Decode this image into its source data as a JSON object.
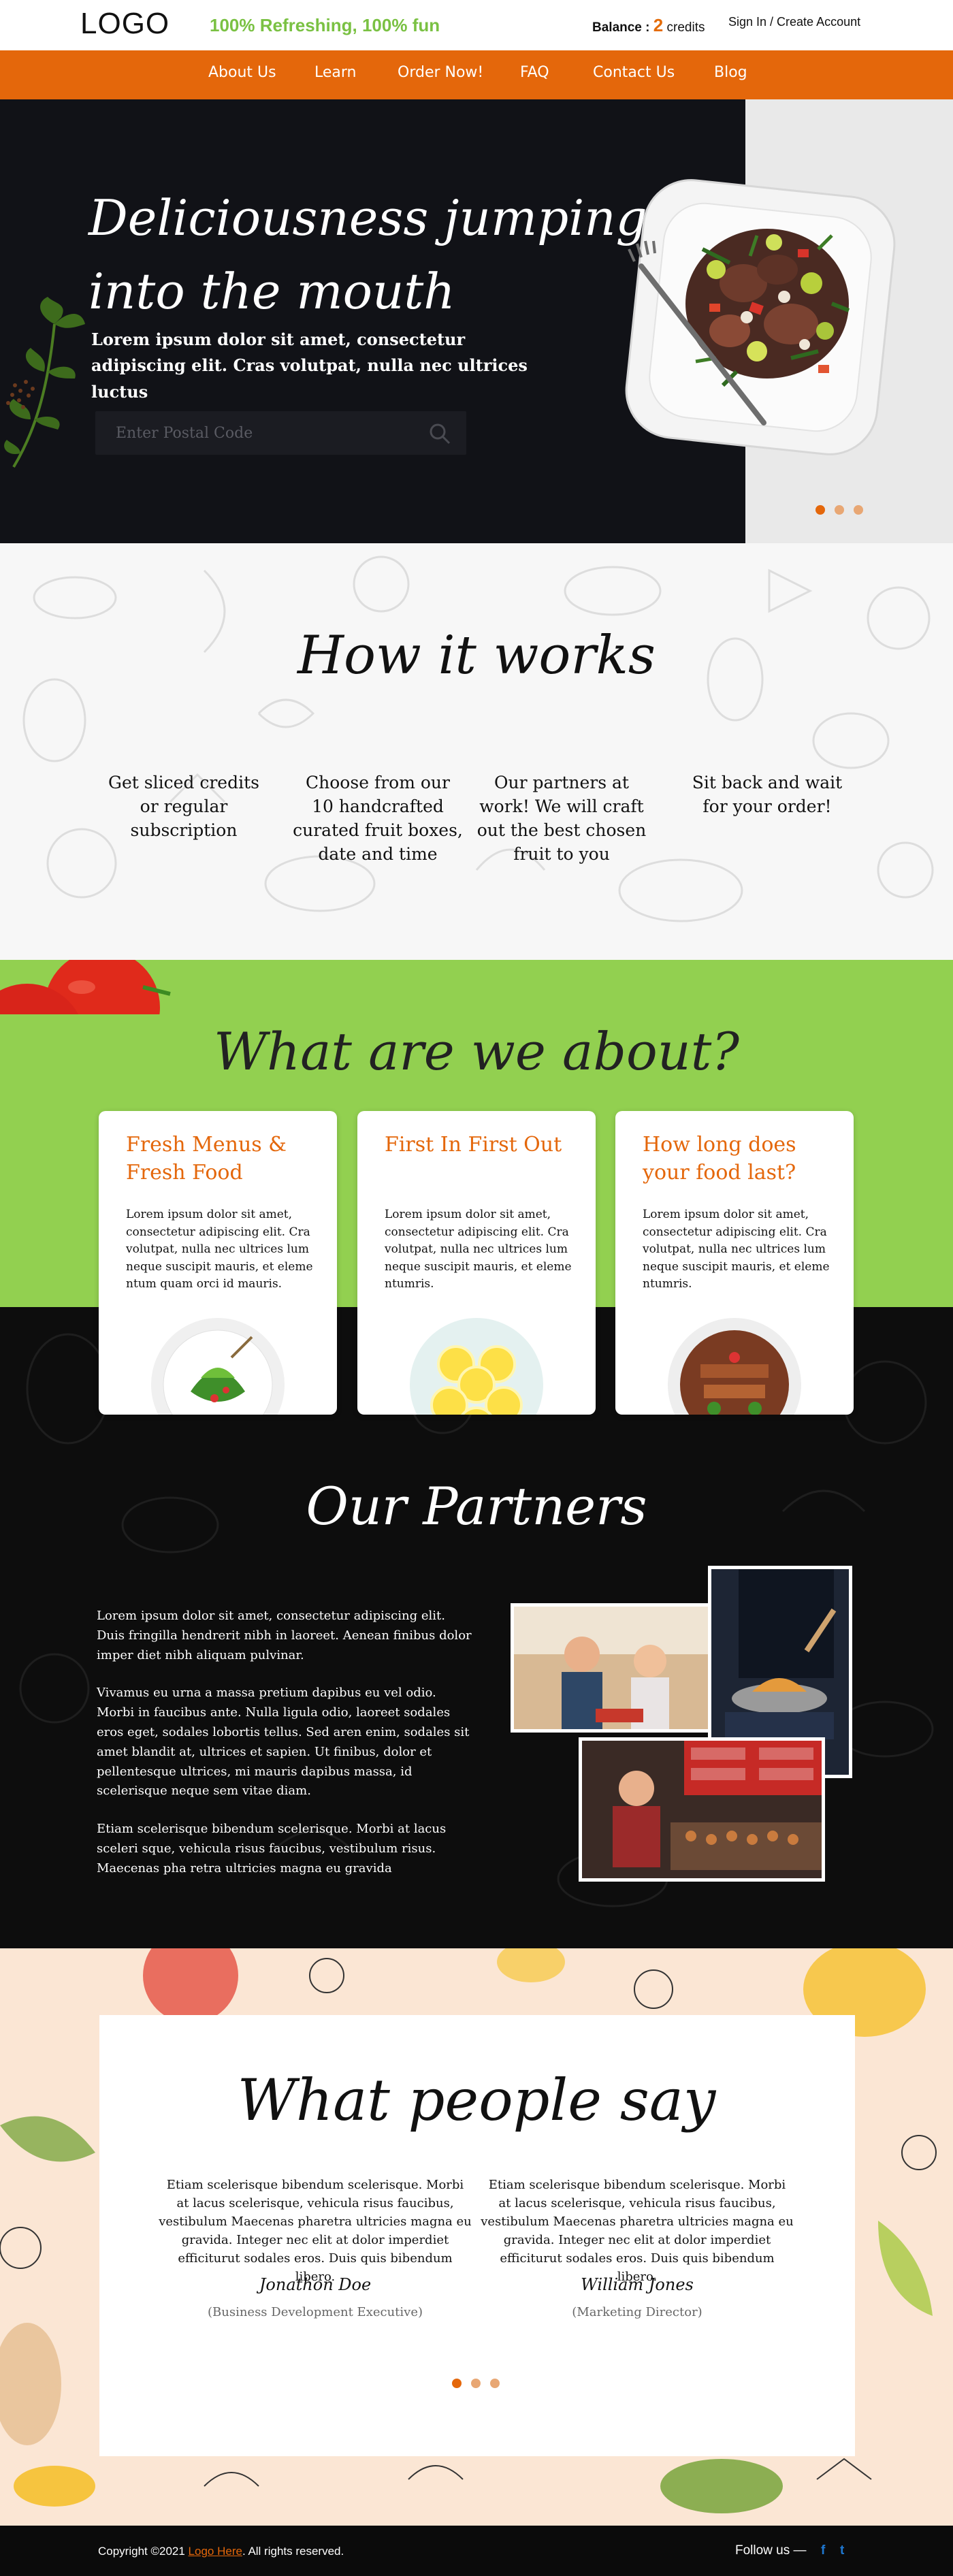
{
  "header": {
    "logo": "LOGO",
    "tagline": "100% Refreshing, 100% fun",
    "balance_label": "Balance :",
    "balance_value": "2",
    "balance_unit": "credits",
    "signin": "Sign In / Create Account"
  },
  "nav": {
    "items": [
      "About Us",
      "Learn",
      "Order Now!",
      "FAQ",
      "Contact Us",
      "Blog"
    ]
  },
  "hero": {
    "title_line1": "Deliciousness jumping",
    "title_line2": "into the mouth",
    "text": "Lorem ipsum dolor sit amet, consectetur adipiscing elit. Cras volutpat, nulla nec ultrices luctus",
    "search_placeholder": "Enter Postal Code",
    "slider_active": 0,
    "colors": {
      "dark": "#111217",
      "accent": "#e4670b"
    }
  },
  "how": {
    "title": "How it works",
    "steps": [
      "Get sliced credits or regular subscription",
      "Choose from our 10 handcrafted curated fruit boxes, date and time",
      "Our partners at work! We will craft out the best chosen fruit to you",
      "Sit back and wait for your order!"
    ]
  },
  "about": {
    "title": "What are we about?",
    "cards": [
      {
        "title": "Fresh Menus & Fresh Food",
        "text": "Lorem ipsum dolor sit amet, consectetur adipiscing elit. Cra volutpat, nulla nec ultrices lum neque suscipit mauris, et eleme ntum quam orci id mauris.",
        "icon": "salad-plate"
      },
      {
        "title": "First In First Out",
        "text": "Lorem ipsum dolor sit amet, consectetur adipiscing elit. Cra volutpat, nulla nec ultrices lum neque suscipit mauris, et eleme ntumris.",
        "icon": "lemon-plate"
      },
      {
        "title": "How long does your food last?",
        "text": "Lorem ipsum dolor sit amet, consectetur adipiscing elit. Cra volutpat, nulla nec ultrices lum neque suscipit mauris, et eleme ntumris.",
        "icon": "grill-plate"
      }
    ],
    "green": "#92d050"
  },
  "partners": {
    "title": "Our Partners",
    "paragraphs": [
      "Lorem ipsum dolor sit amet, consectetur adipiscing elit. Duis fringilla hendrerit nibh in laoreet. Aenean finibus dolor imper diet nibh aliquam pulvinar.",
      "Vivamus eu urna a massa pretium dapibus eu vel odio. Morbi in faucibus ante. Nulla ligula odio, laoreet sodales eros eget, sodales lobortis tellus. Sed aren enim, sodales sit amet blandit at, ultrices et sapien. Ut finibus, dolor et pellentesque ultrices, mi mauris dapibus massa, id scelerisque neque sem vitae diam.",
      "Etiam scelerisque bibendum scelerisque. Morbi at lacus sceleri sque, vehicula risus faucibus, vestibulum risus. Maecenas pha retra ultricies magna eu gravida"
    ]
  },
  "testimonials": {
    "title": "What people say",
    "items": [
      {
        "quote": "Etiam scelerisque bibendum scelerisque. Morbi at lacus scelerisque, vehicula risus faucibus, vestibulum Maecenas pharetra ultricies magna eu gravida. Integer nec elit at dolor imperdiet efficiturut sodales eros. Duis quis bibendum libero.",
        "name": "Jonathon Doe",
        "role": "(Business Development Executive)"
      },
      {
        "quote": "Etiam scelerisque bibendum scelerisque. Morbi at lacus scelerisque, vehicula risus faucibus, vestibulum Maecenas pharetra ultricies magna eu gravida. Integer nec elit at dolor imperdiet efficiturut sodales eros. Duis quis bibendum libero.",
        "name": "William Jones",
        "role": "(Marketing Director)"
      }
    ],
    "slider_active": 0
  },
  "footer": {
    "copy_prefix": "Copyright ©2021 ",
    "brand": "Logo Here",
    "copy_suffix": ". All rights reserved.",
    "follow": "Follow us —",
    "social": [
      "f",
      "t"
    ]
  }
}
